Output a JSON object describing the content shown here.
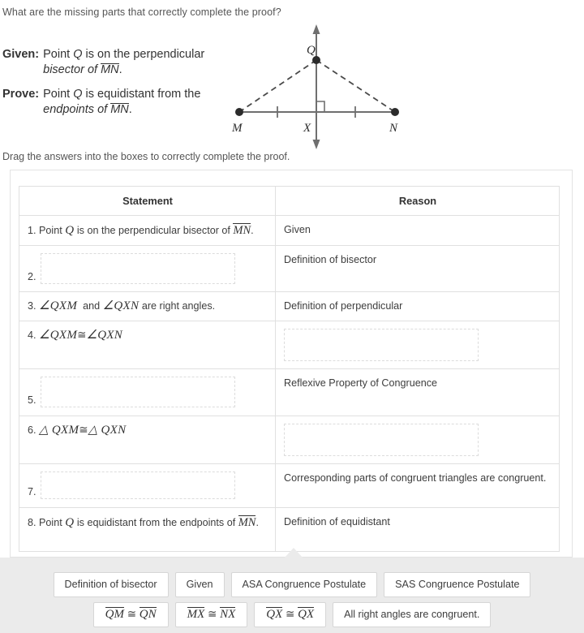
{
  "prompt": "What are the missing parts that correctly complete the proof?",
  "given_prove": {
    "given_label": "Given:",
    "given_line1_pre": "Point ",
    "given_line1_var": "Q",
    "given_line1_post": " is on the perpendicular",
    "given_line2_pre": "bisector ",
    "given_line2_of": "of ",
    "given_line2_seg": "MN",
    "given_line2_period": ".",
    "prove_label": "Prove:",
    "prove_line1_pre": "Point ",
    "prove_line1_var": "Q",
    "prove_line1_post": " is equidistant from the",
    "prove_line2_pre": "endpoints ",
    "prove_line2_of": "of ",
    "prove_line2_seg": "MN",
    "prove_line2_period": "."
  },
  "diagram": {
    "label_Q": "Q",
    "label_M": "M",
    "label_X": "X",
    "label_N": "N",
    "line_color": "#6f6f6f",
    "dash_color": "#4a4a4a",
    "point_color": "#2b2b2b"
  },
  "drag_note": "Drag the answers into the boxes to correctly complete the proof.",
  "table": {
    "headers": [
      "Statement",
      "Reason"
    ],
    "rows": [
      {
        "num": "1.",
        "statement_type": "text",
        "statement_pre": "Point ",
        "statement_var": "Q",
        "statement_mid": " is on the perpendicular bisector of ",
        "statement_seg": "MN",
        "statement_post": ".",
        "reason_type": "text",
        "reason": "Given"
      },
      {
        "num": "2.",
        "statement_type": "drop",
        "reason_type": "text",
        "reason": "Definition of bisector"
      },
      {
        "num": "3.",
        "statement_type": "math",
        "statement_math_a": "∠QXM",
        "statement_math_join": "and",
        "statement_math_b": "∠QXN",
        "statement_math_tail": "are right angles.",
        "reason_type": "text",
        "reason": "Definition of perpendicular"
      },
      {
        "num": "4.",
        "statement_type": "math2",
        "statement_math_a": "∠QXM",
        "statement_math_op": "≅",
        "statement_math_b": "∠QXN",
        "reason_type": "drop"
      },
      {
        "num": "5.",
        "statement_type": "drop",
        "reason_type": "text",
        "reason": "Reflexive Property of Congruence"
      },
      {
        "num": "6.",
        "statement_type": "math3",
        "statement_tri_a": "△ QXM",
        "statement_math_op": "≅",
        "statement_tri_b": "△ QXN",
        "reason_type": "drop"
      },
      {
        "num": "7.",
        "statement_type": "drop",
        "reason_type": "text",
        "reason": "Corresponding parts of congruent triangles are congruent."
      },
      {
        "num": "8.",
        "statement_type": "text8",
        "statement_pre": "Point ",
        "statement_var": "Q",
        "statement_mid": " is equidistant from the endpoints of ",
        "statement_seg": "MN",
        "statement_post": ".",
        "reason_type": "text",
        "reason": "Definition of equidistant"
      }
    ]
  },
  "tray": {
    "row1": [
      {
        "type": "text",
        "label": "Definition of bisector"
      },
      {
        "type": "text",
        "label": "Given"
      },
      {
        "type": "text",
        "label": "ASA Congruence Postulate"
      },
      {
        "type": "text",
        "label": "SAS Congruence Postulate"
      }
    ],
    "row2": [
      {
        "type": "math",
        "seg_a": "QM",
        "op": "≅",
        "seg_b": "QN"
      },
      {
        "type": "math",
        "seg_a": "MX",
        "op": "≅",
        "seg_b": "NX"
      },
      {
        "type": "math",
        "seg_a": "QX",
        "op": "≅",
        "seg_b": "QX"
      },
      {
        "type": "text",
        "label": "All right angles are congruent."
      }
    ]
  }
}
